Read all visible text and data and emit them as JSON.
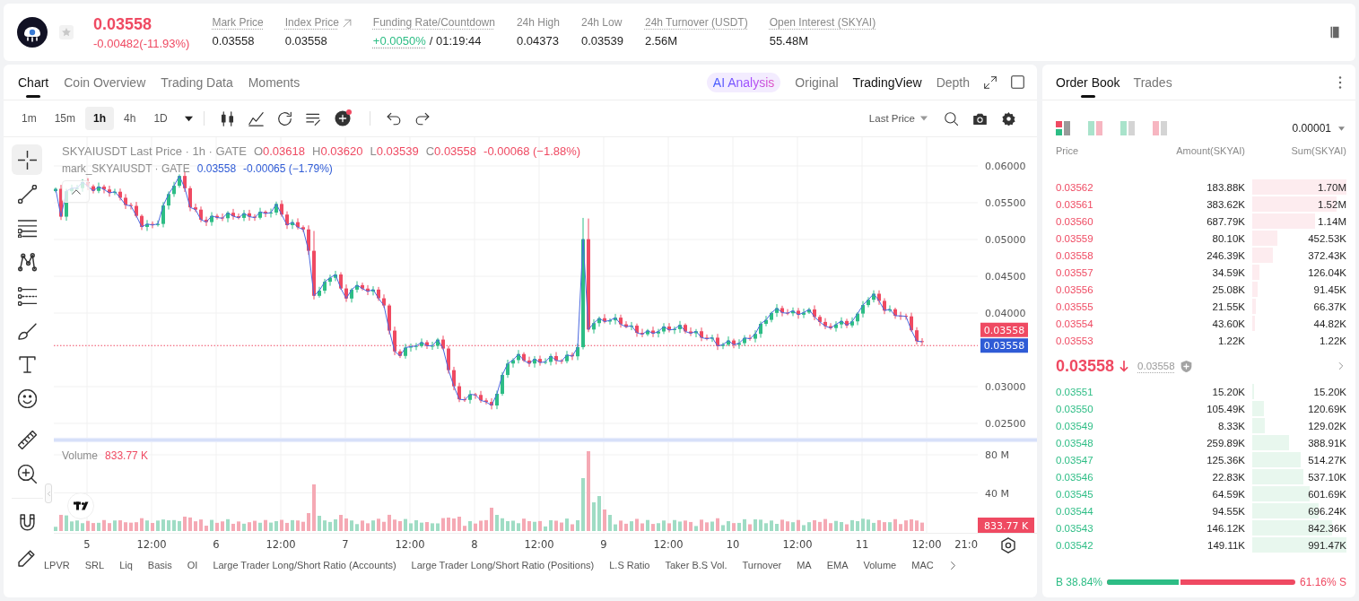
{
  "header": {
    "price": "0.03558",
    "change": "-0.00482(-11.93%)",
    "negative": true,
    "favorite": false,
    "stats": [
      {
        "kind": "plain",
        "label": "Mark Price",
        "value": "0.03558",
        "tooltip": true,
        "positive": false,
        "value_tooltip": false
      },
      {
        "kind": "link",
        "label": "Index Price",
        "value": "0.03558",
        "tooltip": true,
        "positive": false,
        "value_tooltip": false
      },
      {
        "kind": "plain",
        "label": "Funding Rate/Countdown",
        "value": "+0.0050%",
        "countdown": "/ 01:19:44",
        "tooltip": true,
        "positive": true,
        "value_tooltip": true
      },
      {
        "kind": "plain",
        "label": "24h High",
        "value": "0.04373",
        "tooltip": false,
        "positive": false,
        "value_tooltip": false
      },
      {
        "kind": "plain",
        "label": "24h Low",
        "value": "0.03539",
        "tooltip": false,
        "positive": false,
        "value_tooltip": false
      },
      {
        "kind": "plain",
        "label": "24h Turnover (USDT)",
        "value": "2.56M",
        "tooltip": true,
        "positive": false,
        "value_tooltip": false
      },
      {
        "kind": "plain",
        "label": "Open Interest (SKYAI)",
        "value": "55.48M",
        "tooltip": true,
        "positive": false,
        "value_tooltip": false
      }
    ]
  },
  "chart_tabs": [
    {
      "label": "Chart",
      "selected": true
    },
    {
      "label": "Coin Overview",
      "selected": false
    },
    {
      "label": "Trading Data",
      "selected": false
    },
    {
      "label": "Moments",
      "selected": false
    }
  ],
  "ai_button": {
    "label": "AI Analysis"
  },
  "views": [
    {
      "label": "Original",
      "selected": false
    },
    {
      "label": "TradingView",
      "selected": true
    },
    {
      "label": "Depth",
      "selected": false
    }
  ],
  "intervals": [
    {
      "label": "1m",
      "selected": false
    },
    {
      "label": "15m",
      "selected": false
    },
    {
      "label": "1h",
      "selected": true
    },
    {
      "label": "4h",
      "selected": false
    },
    {
      "label": "1D",
      "selected": false
    }
  ],
  "price_type": "Last Price",
  "drawing_tools": [
    {
      "tools": [
        {
          "kind": "crosshair",
          "selected": true
        },
        {
          "kind": "trend_line",
          "selected": false
        },
        {
          "kind": "parallel_lines",
          "selected": false
        },
        {
          "kind": "pattern",
          "selected": false
        },
        {
          "kind": "fib",
          "selected": false
        },
        {
          "kind": "brush",
          "selected": false
        },
        {
          "kind": "text",
          "selected": false
        },
        {
          "kind": "emoji",
          "selected": false
        }
      ]
    },
    {
      "tools": [
        {
          "kind": "ruler",
          "selected": false
        },
        {
          "kind": "zoom",
          "selected": false
        }
      ]
    },
    {
      "tools": [
        {
          "kind": "magnet",
          "selected": false
        },
        {
          "kind": "pencil",
          "selected": false
        }
      ]
    }
  ],
  "legend": {
    "title": "SKYAIUSDT Last Price · 1h · GATE",
    "ohlc": [
      {
        "label": "O",
        "value": "0.03618"
      },
      {
        "label": "H",
        "value": "0.03620"
      },
      {
        "label": "L",
        "value": "0.03539"
      },
      {
        "label": "C",
        "value": "0.03558"
      }
    ],
    "change": "-0.00068 (−1.88%)",
    "mark_title": "mark_SKYAIUSDT · GATE",
    "mark_value": "0.03558",
    "mark_change": "-0.00065 (−1.79%)"
  },
  "price_axis": {
    "ticks": [
      "0.06000",
      "0.05500",
      "0.05000",
      "0.04500",
      "0.04000",
      "0.03000",
      "0.02500"
    ],
    "last_price": "0.03558",
    "mark_price": "0.03558"
  },
  "volume": {
    "label": "Volume",
    "value": "833.77 K",
    "ticks": [
      "80 M",
      "40 M"
    ],
    "last": "833.77 K"
  },
  "time_axis": [
    "5",
    "12:00",
    "6",
    "12:00",
    "7",
    "12:00",
    "8",
    "12:00",
    "9",
    "12:00",
    "10",
    "12:00",
    "11",
    "12:00",
    "21:0"
  ],
  "indicators": [
    "LPVR",
    "SRL",
    "Liq",
    "Basis",
    "OI",
    "Large Trader Long/Short Ratio (Accounts)",
    "Large Trader Long/Short Ratio (Positions)",
    "L.S Ratio",
    "Taker B.S Vol.",
    "Turnover",
    "MA",
    "EMA",
    "Volume",
    "MAC"
  ],
  "order_book": {
    "tabs": [
      {
        "label": "Order Book",
        "selected": true
      },
      {
        "label": "Trades",
        "selected": false
      }
    ],
    "layouts": [
      {
        "kind": "both",
        "selected": true
      },
      {
        "kind": "split",
        "selected": false
      },
      {
        "kind": "bids",
        "selected": false
      },
      {
        "kind": "asks",
        "selected": false
      }
    ],
    "precision": "0.00001",
    "columns": [
      "Price",
      "Amount(SKYAI)",
      "Sum(SKYAI)"
    ],
    "asks": [
      {
        "price": "0.03562",
        "amount": "183.88K",
        "sum": "1.70M"
      },
      {
        "price": "0.03561",
        "amount": "383.62K",
        "sum": "1.52M"
      },
      {
        "price": "0.03560",
        "amount": "687.79K",
        "sum": "1.14M"
      },
      {
        "price": "0.03559",
        "amount": "80.10K",
        "sum": "452.53K"
      },
      {
        "price": "0.03558",
        "amount": "246.39K",
        "sum": "372.43K"
      },
      {
        "price": "0.03557",
        "amount": "34.59K",
        "sum": "126.04K"
      },
      {
        "price": "0.03556",
        "amount": "25.08K",
        "sum": "91.45K"
      },
      {
        "price": "0.03555",
        "amount": "21.55K",
        "sum": "66.37K"
      },
      {
        "price": "0.03554",
        "amount": "43.60K",
        "sum": "44.82K"
      },
      {
        "price": "0.03553",
        "amount": "1.22K",
        "sum": "1.22K"
      }
    ],
    "last_price": "0.03558",
    "falling": true,
    "mark_price": "0.03558",
    "bids": [
      {
        "price": "0.03551",
        "amount": "15.20K",
        "sum": "15.20K"
      },
      {
        "price": "0.03550",
        "amount": "105.49K",
        "sum": "120.69K"
      },
      {
        "price": "0.03549",
        "amount": "8.33K",
        "sum": "129.02K"
      },
      {
        "price": "0.03548",
        "amount": "259.89K",
        "sum": "388.91K"
      },
      {
        "price": "0.03547",
        "amount": "125.36K",
        "sum": "514.27K"
      },
      {
        "price": "0.03546",
        "amount": "22.83K",
        "sum": "537.10K"
      },
      {
        "price": "0.03545",
        "amount": "64.59K",
        "sum": "601.69K"
      },
      {
        "price": "0.03544",
        "amount": "94.55K",
        "sum": "696.24K"
      },
      {
        "price": "0.03543",
        "amount": "146.12K",
        "sum": "842.36K"
      },
      {
        "price": "0.03542",
        "amount": "149.11K",
        "sum": "991.47K"
      }
    ],
    "ratio": {
      "buy": "B 38.84%",
      "sell": "61.16% S",
      "level": 0.3884
    }
  }
}
